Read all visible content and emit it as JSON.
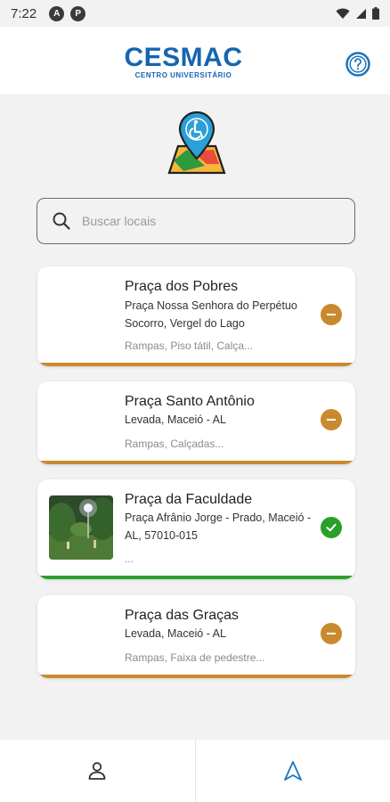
{
  "status_bar": {
    "time": "7:22",
    "badge_a": "A",
    "badge_b": "P"
  },
  "header": {
    "logo_word": "CESMAC",
    "logo_sub": "CENTRO UNIVERSITÁRIO"
  },
  "search": {
    "placeholder": "Buscar locais",
    "value": ""
  },
  "colors": {
    "accent": "#1b75bc",
    "partial": "#c98a2e",
    "ok": "#2aa02a"
  },
  "places": [
    {
      "title": "Praça dos Pobres",
      "address": "Praça Nossa Senhora do Perpétuo Socorro, Vergel do Lago",
      "tags": "Rampas, Piso tátil, Calça...",
      "status": "partial",
      "status_icon": "minus-icon"
    },
    {
      "title": "Praça Santo Antônio",
      "address": "Levada, Maceió - AL",
      "tags": "Rampas, Calçadas...",
      "status": "partial",
      "status_icon": "minus-icon"
    },
    {
      "title": "Praça da Faculdade",
      "address": " Praça Afrânio Jorge - Prado, Maceió - AL, 57010-015",
      "tags": "...",
      "status": "ok",
      "status_icon": "check-icon"
    },
    {
      "title": "Praça das Graças",
      "address": "Levada, Maceió - AL",
      "tags": "Rampas, Faixa de pedestre...",
      "status": "partial",
      "status_icon": "minus-icon"
    }
  ],
  "bottom_nav": {
    "items": [
      {
        "icon": "person-icon"
      },
      {
        "icon": "navigation-arrow-icon"
      }
    ]
  }
}
